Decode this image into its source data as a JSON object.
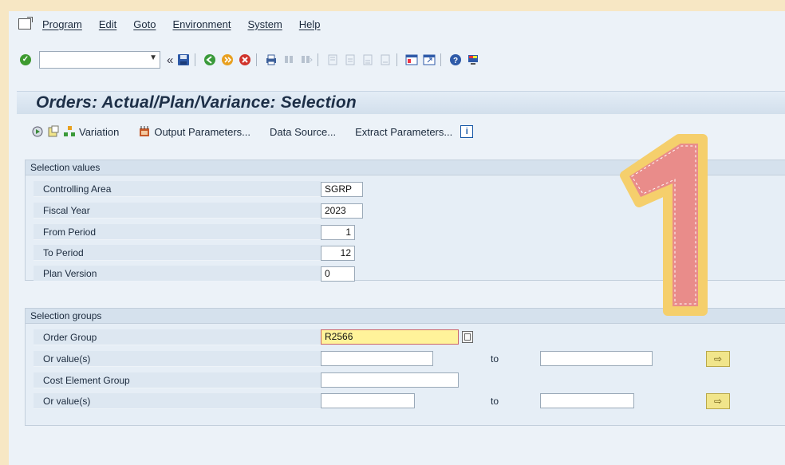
{
  "menu": {
    "items": [
      "Program",
      "Edit",
      "Goto",
      "Environment",
      "System",
      "Help"
    ]
  },
  "toolbar": {
    "command_value": "",
    "back_glyph": "«"
  },
  "screen": {
    "title": "Orders: Actual/Plan/Variance: Selection"
  },
  "app_toolbar": {
    "variation_label": "Variation",
    "output_label": "Output Parameters...",
    "datasource_label": "Data Source...",
    "extract_label": "Extract Parameters..."
  },
  "selection_values": {
    "header": "Selection values",
    "rows": [
      {
        "label": "Controlling Area",
        "value": "SGRP"
      },
      {
        "label": "Fiscal Year",
        "value": "2023"
      },
      {
        "label": "From Period",
        "value": "1"
      },
      {
        "label": "To Period",
        "value": "12"
      },
      {
        "label": "Plan Version",
        "value": "0"
      }
    ]
  },
  "selection_groups": {
    "header": "Selection groups",
    "order_group_label": "Order Group",
    "order_group_value": "R2566",
    "or_values_label_1": "Or value(s)",
    "cost_element_group_label": "Cost Element Group",
    "or_values_label_2": "Or value(s)",
    "to_label_1": "to",
    "to_label_2": "to"
  },
  "annotation": {
    "number": "1",
    "fill_color": "#e98c8a",
    "outline_color": "#f5cf6c"
  },
  "colors": {
    "background": "#f7e7c4",
    "window": "#ecf2f8",
    "focus_field": "#fff39a"
  }
}
